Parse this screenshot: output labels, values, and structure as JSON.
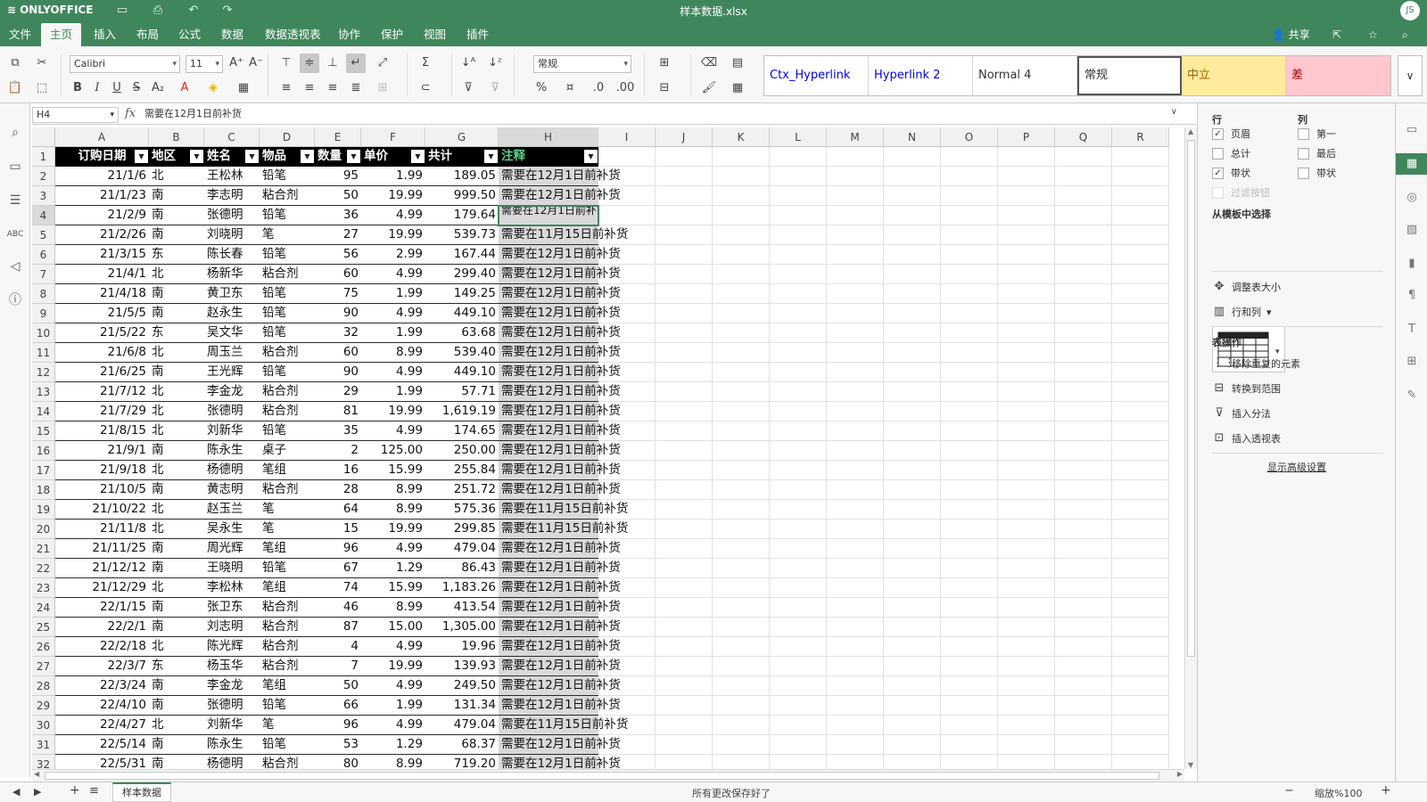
{
  "app": {
    "logo": "ONLYOFFICE",
    "title": "样本数据.xlsx",
    "user_initials": "JS"
  },
  "menu": {
    "tabs": [
      "文件",
      "主页",
      "插入",
      "布局",
      "公式",
      "数据",
      "数据透视表",
      "协作",
      "保护",
      "视图",
      "插件"
    ],
    "active_tab": "主页",
    "share_label": "共享"
  },
  "toolbar": {
    "font_name": "Calibri",
    "font_size": "11",
    "number_format": "常规",
    "cell_styles": [
      "Ctx_Hyperlink",
      "Hyperlink 2",
      "Normal 4",
      "常规",
      "中立",
      "差"
    ]
  },
  "formula_bar": {
    "cell_ref": "H4",
    "fx_label": "fx",
    "value": "需要在12月1日前补货"
  },
  "colors": {
    "brand": "#40865c",
    "neutral_style_bg": "#ffeb9c",
    "neutral_style_fg": "#9c6500",
    "bad_style_bg": "#ffc7ce",
    "bad_style_fg": "#9c0006",
    "hyperlink": "#0000ee",
    "header_note_color": "#5bd08a"
  },
  "grid": {
    "columns": [
      "A",
      "B",
      "C",
      "D",
      "E",
      "F",
      "G",
      "H",
      "I",
      "J",
      "K",
      "L",
      "M",
      "N",
      "O",
      "P",
      "Q",
      "R"
    ],
    "row_numbers": [
      "1",
      "2",
      "3",
      "4",
      "5",
      "6",
      "7",
      "8",
      "9",
      "10",
      "11",
      "12",
      "13",
      "14",
      "15",
      "16",
      "17",
      "18",
      "19",
      "20",
      "21",
      "22",
      "23",
      "24",
      "25",
      "26",
      "27",
      "28",
      "29",
      "30",
      "31",
      "32"
    ],
    "headers": [
      "订购日期",
      "地区",
      "姓名",
      "物品",
      "数量",
      "单价",
      "共计",
      "注释"
    ],
    "rows": [
      [
        "21/1/6",
        "北",
        "王松林",
        "铅笔",
        "95",
        "1.99",
        "189.05",
        "需要在12月1日前补货"
      ],
      [
        "21/1/23",
        "南",
        "李志明",
        "粘合剂",
        "50",
        "19.99",
        "999.50",
        "需要在12月1日前补货"
      ],
      [
        "21/2/9",
        "南",
        "张德明",
        "铅笔",
        "36",
        "4.99",
        "179.64",
        "需要在12月1日前补货"
      ],
      [
        "21/2/26",
        "南",
        "刘晓明",
        "笔",
        "27",
        "19.99",
        "539.73",
        "需要在11月15日前补货"
      ],
      [
        "21/3/15",
        "东",
        "陈长春",
        "铅笔",
        "56",
        "2.99",
        "167.44",
        "需要在12月1日前补货"
      ],
      [
        "21/4/1",
        "北",
        "杨新华",
        "粘合剂",
        "60",
        "4.99",
        "299.40",
        "需要在12月1日前补货"
      ],
      [
        "21/4/18",
        "南",
        "黄卫东",
        "铅笔",
        "75",
        "1.99",
        "149.25",
        "需要在12月1日前补货"
      ],
      [
        "21/5/5",
        "南",
        "赵永生",
        "铅笔",
        "90",
        "4.99",
        "449.10",
        "需要在12月1日前补货"
      ],
      [
        "21/5/22",
        "东",
        "吴文华",
        "铅笔",
        "32",
        "1.99",
        "63.68",
        "需要在12月1日前补货"
      ],
      [
        "21/6/8",
        "北",
        "周玉兰",
        "粘合剂",
        "60",
        "8.99",
        "539.40",
        "需要在12月1日前补货"
      ],
      [
        "21/6/25",
        "南",
        "王光辉",
        "铅笔",
        "90",
        "4.99",
        "449.10",
        "需要在12月1日前补货"
      ],
      [
        "21/7/12",
        "北",
        "李金龙",
        "粘合剂",
        "29",
        "1.99",
        "57.71",
        "需要在12月1日前补货"
      ],
      [
        "21/7/29",
        "北",
        "张德明",
        "粘合剂",
        "81",
        "19.99",
        "1,619.19",
        "需要在12月1日前补货"
      ],
      [
        "21/8/15",
        "北",
        "刘新华",
        "铅笔",
        "35",
        "4.99",
        "174.65",
        "需要在12月1日前补货"
      ],
      [
        "21/9/1",
        "南",
        "陈永生",
        "桌子",
        "2",
        "125.00",
        "250.00",
        "需要在12月1日前补货"
      ],
      [
        "21/9/18",
        "北",
        "杨德明",
        "笔组",
        "16",
        "15.99",
        "255.84",
        "需要在12月1日前补货"
      ],
      [
        "21/10/5",
        "南",
        "黄志明",
        "粘合剂",
        "28",
        "8.99",
        "251.72",
        "需要在12月1日前补货"
      ],
      [
        "21/10/22",
        "北",
        "赵玉兰",
        "笔",
        "64",
        "8.99",
        "575.36",
        "需要在11月15日前补货"
      ],
      [
        "21/11/8",
        "北",
        "吴永生",
        "笔",
        "15",
        "19.99",
        "299.85",
        "需要在11月15日前补货"
      ],
      [
        "21/11/25",
        "南",
        "周光辉",
        "笔组",
        "96",
        "4.99",
        "479.04",
        "需要在12月1日前补货"
      ],
      [
        "21/12/12",
        "南",
        "王晓明",
        "铅笔",
        "67",
        "1.29",
        "86.43",
        "需要在12月1日前补货"
      ],
      [
        "21/12/29",
        "北",
        "李松林",
        "笔组",
        "74",
        "15.99",
        "1,183.26",
        "需要在12月1日前补货"
      ],
      [
        "22/1/15",
        "南",
        "张卫东",
        "粘合剂",
        "46",
        "8.99",
        "413.54",
        "需要在12月1日前补货"
      ],
      [
        "22/2/1",
        "南",
        "刘志明",
        "粘合剂",
        "87",
        "15.00",
        "1,305.00",
        "需要在12月1日前补货"
      ],
      [
        "22/2/18",
        "北",
        "陈光辉",
        "粘合剂",
        "4",
        "4.99",
        "19.96",
        "需要在12月1日前补货"
      ],
      [
        "22/3/7",
        "东",
        "杨玉华",
        "粘合剂",
        "7",
        "19.99",
        "139.93",
        "需要在12月1日前补货"
      ],
      [
        "22/3/24",
        "南",
        "李金龙",
        "笔组",
        "50",
        "4.99",
        "249.50",
        "需要在12月1日前补货"
      ],
      [
        "22/4/10",
        "南",
        "张德明",
        "铅笔",
        "66",
        "1.99",
        "131.34",
        "需要在12月1日前补货"
      ],
      [
        "22/4/27",
        "北",
        "刘新华",
        "笔",
        "96",
        "4.99",
        "479.04",
        "需要在11月15日前补货"
      ],
      [
        "22/5/14",
        "南",
        "陈永生",
        "铅笔",
        "53",
        "1.29",
        "68.37",
        "需要在12月1日前补货"
      ],
      [
        "22/5/31",
        "南",
        "杨德明",
        "粘合剂",
        "80",
        "8.99",
        "719.20",
        "需要在12月1日前补货"
      ]
    ],
    "selected_cell": "H4",
    "selected_wrapped_text": "需要在12月1日前补货"
  },
  "right_panel": {
    "rows_title": "行",
    "cols_title": "列",
    "rows_options": [
      {
        "label": "页眉",
        "checked": true
      },
      {
        "label": "总计",
        "checked": false
      },
      {
        "label": "带状",
        "checked": true
      }
    ],
    "cols_options": [
      {
        "label": "第一",
        "checked": false
      },
      {
        "label": "最后",
        "checked": false
      },
      {
        "label": "带状",
        "checked": false
      }
    ],
    "filter_button_label": "过滤按钮",
    "template_title": "从模板中选择",
    "resize_label": "调整表大小",
    "rows_cols_label": "行和列",
    "table_ops_title": "表操作",
    "ops": [
      "移除重复的元素",
      "转换到范围",
      "插入分法",
      "插入透视表"
    ],
    "advanced_label": "显示高级设置"
  },
  "status": {
    "sheet_name": "样本数据",
    "save_status": "所有更改保存好了",
    "zoom": "缩放%100"
  }
}
